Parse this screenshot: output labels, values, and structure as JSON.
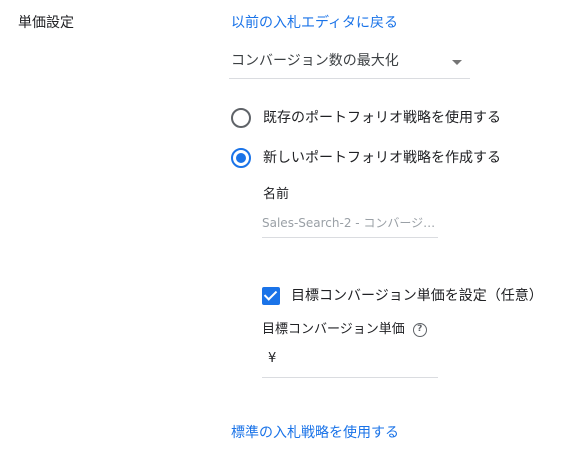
{
  "section": {
    "label": "単価設定",
    "back_link": "以前の入札エディタに戻る"
  },
  "strategy_dropdown": {
    "selected": "コンバージョン数の最大化"
  },
  "radio_options": [
    {
      "label": "既存のポートフォリオ戦略を使用する",
      "selected": false
    },
    {
      "label": "新しいポートフォリオ戦略を作成する",
      "selected": true
    }
  ],
  "new_strategy": {
    "name_label": "名前",
    "name_value": "Sales-Search-2 - コンバージ…",
    "target_checkbox_label": "目標コンバージョン単価を設定（任意）",
    "target_checkbox_checked": true,
    "target_cpa_label": "目標コンバージョン単価",
    "help_icon": "help-icon",
    "currency_symbol": "¥",
    "target_cpa_value": ""
  },
  "standard_link": "標準の入札戦略を使用する",
  "colors": {
    "accent": "#1a73e8",
    "text": "#202124",
    "muted": "#9aa0a6",
    "divider": "#dadce0"
  }
}
